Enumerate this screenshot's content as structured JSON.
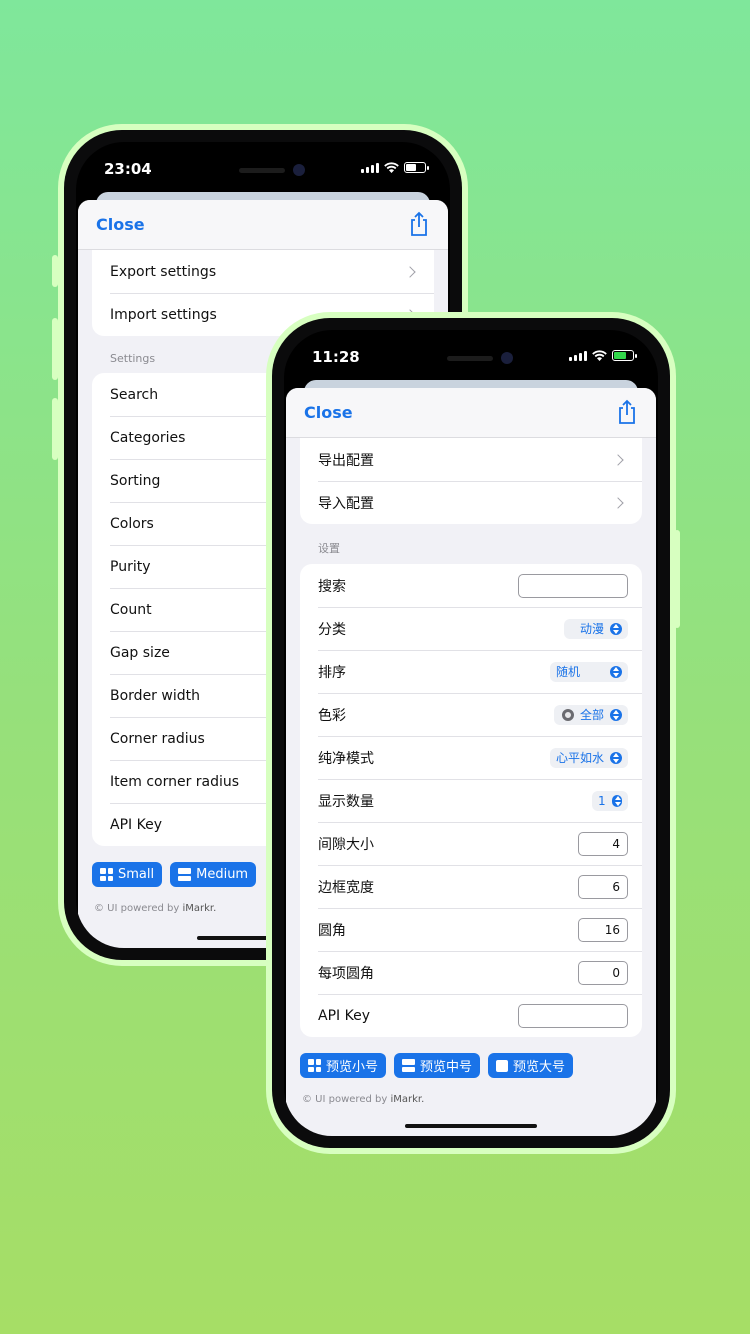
{
  "back_phone": {
    "time": "23:04",
    "nav": {
      "close": "Close"
    },
    "top_rows": [
      {
        "label": "Export settings"
      },
      {
        "label": "Import settings"
      }
    ],
    "settings_title": "Settings",
    "settings_rows": [
      "Search",
      "Categories",
      "Sorting",
      "Colors",
      "Purity",
      "Count",
      "Gap size",
      "Border width",
      "Corner radius",
      "Item corner radius",
      "API Key"
    ],
    "preview_buttons": [
      "Small",
      "Medium"
    ],
    "footer": {
      "prefix": "© UI powered by ",
      "brand": "iMarkr."
    }
  },
  "front_phone": {
    "time": "11:28",
    "nav": {
      "close": "Close"
    },
    "top_rows": [
      {
        "label": "导出配置"
      },
      {
        "label": "导入配置"
      }
    ],
    "settings_title": "设置",
    "settings_rows": {
      "search": {
        "label": "搜索",
        "value": ""
      },
      "categories": {
        "label": "分类",
        "value": "动漫"
      },
      "sorting": {
        "label": "排序",
        "value": "随机"
      },
      "colors": {
        "label": "色彩",
        "value": "全部"
      },
      "purity": {
        "label": "纯净模式",
        "value": "心平如水"
      },
      "count": {
        "label": "显示数量",
        "value": "1"
      },
      "gap": {
        "label": "间隙大小",
        "value": "4"
      },
      "border": {
        "label": "边框宽度",
        "value": "6"
      },
      "corner": {
        "label": "圆角",
        "value": "16"
      },
      "item_corner": {
        "label": "每项圆角",
        "value": "0"
      },
      "api_key": {
        "label": "API Key",
        "value": ""
      }
    },
    "preview_buttons": [
      "预览小号",
      "预览中号",
      "预览大号"
    ],
    "footer": {
      "prefix": "© UI powered by ",
      "brand": "iMarkr."
    }
  },
  "colors": {
    "accent": "#1a73e8",
    "background_top": "#7fe79b",
    "background_bottom": "#a6de66",
    "bezel_frame": "#d7ffc0"
  }
}
